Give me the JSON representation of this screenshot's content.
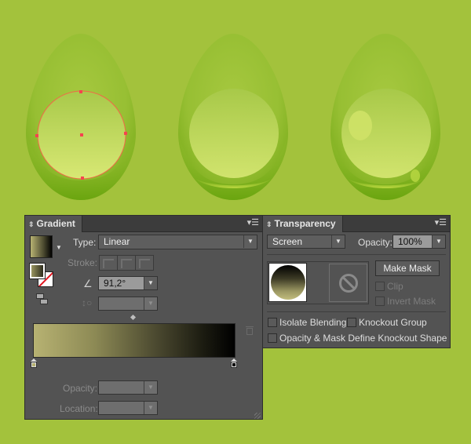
{
  "artwork": {
    "description": "three green glossy egg illustrations on green background",
    "background_color": "#a3c23c",
    "eggs": [
      {
        "name": "egg-with-selected-circle",
        "selection_color": "#f35a4c"
      },
      {
        "name": "egg-glossy"
      },
      {
        "name": "egg-with-highlights"
      }
    ]
  },
  "gradient_panel": {
    "tab_label": "Gradient",
    "type_label": "Type:",
    "type_value": "Linear",
    "stroke_label": "Stroke:",
    "angle_value": "91,2°",
    "aspect_value": "",
    "opacity_label": "Opacity:",
    "opacity_value": "",
    "location_label": "Location:",
    "location_value": "",
    "gradient_stops": [
      {
        "color": "#b7b272",
        "location_percent": 0
      },
      {
        "color": "#000000",
        "location_percent": 100
      }
    ]
  },
  "transparency_panel": {
    "tab_label": "Transparency",
    "blend_mode": "Screen",
    "opacity_label": "Opacity:",
    "opacity_value": "100%",
    "make_mask_label": "Make Mask",
    "clip_label": "Clip",
    "invert_mask_label": "Invert Mask",
    "isolate_blending_label": "Isolate Blending",
    "knockout_group_label": "Knockout Group",
    "opacity_mask_knockout_label": "Opacity & Mask Define Knockout Shape"
  }
}
